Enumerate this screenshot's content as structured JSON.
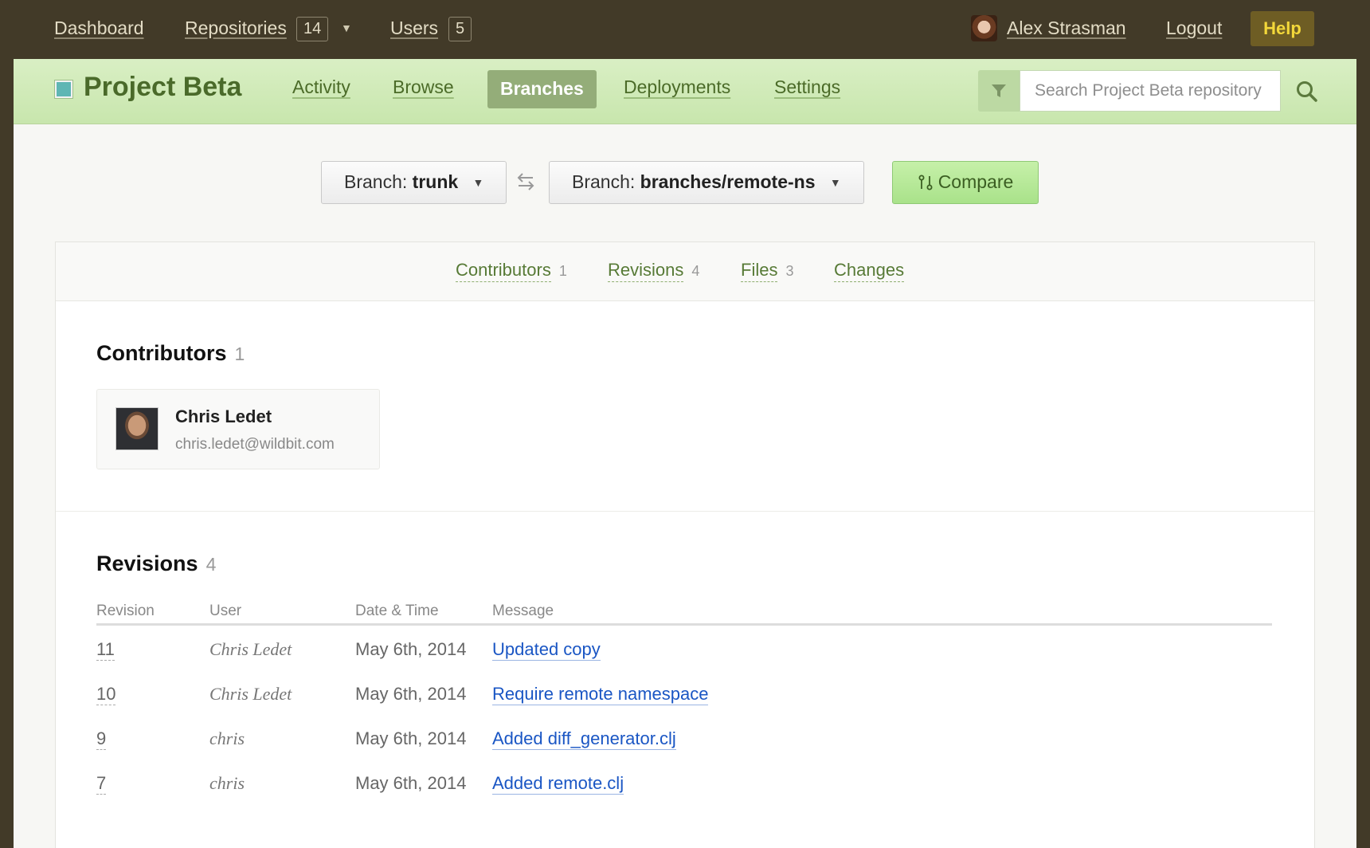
{
  "topnav": {
    "dashboard": "Dashboard",
    "repositories": "Repositories",
    "repositories_count": "14",
    "users": "Users",
    "users_count": "5",
    "user_name": "Alex Strasman",
    "logout": "Logout",
    "help": "Help"
  },
  "project": {
    "title": "Project Beta",
    "color": "#5fb6b4",
    "tabs": [
      "Activity",
      "Browse",
      "Branches",
      "Deployments",
      "Settings"
    ],
    "active_tab": "Branches",
    "search_placeholder": "Search Project Beta repository"
  },
  "compare": {
    "branch_label": "Branch:",
    "base_branch": "trunk",
    "head_branch": "branches/remote-ns",
    "compare_label": "Compare"
  },
  "summary_tabs": [
    {
      "label": "Contributors",
      "count": "1"
    },
    {
      "label": "Revisions",
      "count": "4"
    },
    {
      "label": "Files",
      "count": "3"
    },
    {
      "label": "Changes",
      "count": ""
    }
  ],
  "contributors": {
    "title": "Contributors",
    "count": "1",
    "items": [
      {
        "name": "Chris Ledet",
        "email": "chris.ledet@wildbit.com"
      }
    ]
  },
  "revisions": {
    "title": "Revisions",
    "count": "4",
    "columns": [
      "Revision",
      "User",
      "Date & Time",
      "Message"
    ],
    "rows": [
      {
        "revision": "11",
        "user": "Chris Ledet",
        "date": "May 6th, 2014",
        "message": "Updated copy"
      },
      {
        "revision": "10",
        "user": "Chris Ledet",
        "date": "May 6th, 2014",
        "message": "Require remote namespace"
      },
      {
        "revision": "9",
        "user": "chris",
        "date": "May 6th, 2014",
        "message": "Added diff_generator.clj"
      },
      {
        "revision": "7",
        "user": "chris",
        "date": "May 6th, 2014",
        "message": "Added remote.clj"
      }
    ]
  }
}
